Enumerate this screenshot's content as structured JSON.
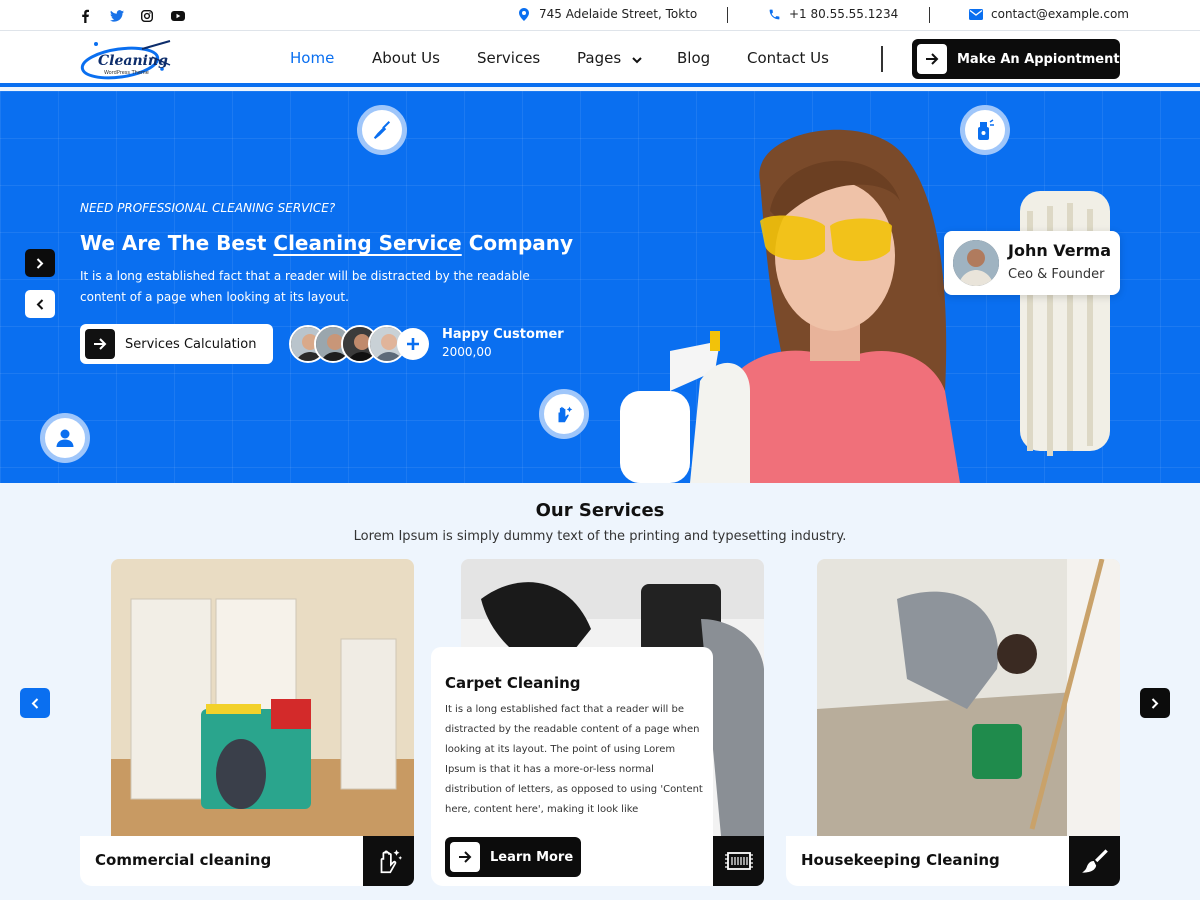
{
  "colors": {
    "primary": "#0a6ff0",
    "dark": "#0c0c0c",
    "white": "#ffffff",
    "section_bg": "#eef5fd"
  },
  "topbar": {
    "social": [
      {
        "name": "facebook-icon",
        "glyph": "f"
      },
      {
        "name": "twitter-icon",
        "glyph": "t"
      },
      {
        "name": "instagram-icon",
        "glyph": "ig"
      },
      {
        "name": "youtube-icon",
        "glyph": "yt"
      }
    ],
    "address": "745 Adelaide Street, Tokto",
    "phone": "+1  80.55.55.1234",
    "email": "contact@example.com"
  },
  "nav": {
    "logo_text": "Cleaning",
    "logo_sub": "WordPress Theme",
    "items": [
      {
        "label": "Home",
        "active": true
      },
      {
        "label": "About Us"
      },
      {
        "label": "Services"
      },
      {
        "label": "Pages",
        "has_dropdown": true
      },
      {
        "label": "Blog"
      },
      {
        "label": "Contact Us"
      }
    ],
    "cta_label": "Make An Appiontment"
  },
  "hero": {
    "eyebrow": "NEED PROFESSIONAL CLEANING SERVICE?",
    "title_pre": "We Are The Best ",
    "title_highlight": "Cleaning Service",
    "title_post": " Company",
    "description": "It is a long established fact that a reader will be distracted by the readable content of a page when looking at its layout.",
    "calc_button": "Services Calculation",
    "happy_title": "Happy Customer",
    "happy_count": "2000,00",
    "founder": {
      "name": "John Verma",
      "role": "Ceo & Founder"
    },
    "floating_icons": [
      "broom-icon",
      "spray-bottle-icon",
      "clean-hand-icon",
      "user-icon"
    ]
  },
  "services": {
    "heading": "Our Services",
    "subheading": "Lorem Ipsum is simply dummy text of the printing and typesetting industry.",
    "cards": [
      {
        "title": "Commercial cleaning",
        "icon": "sparkle-hand-icon"
      },
      {
        "title": "Carpet Cleaning",
        "description": "It is a long established fact that a reader will be distracted by the readable content of a page when looking at its layout. The point of using Lorem Ipsum is that it has a more-or-less normal distribution of letters, as opposed to using 'Content here, content here', making it look like",
        "button": "Learn More",
        "icon": "carpet-icon"
      },
      {
        "title": "Housekeeping Cleaning",
        "icon": "brush-icon"
      }
    ]
  }
}
